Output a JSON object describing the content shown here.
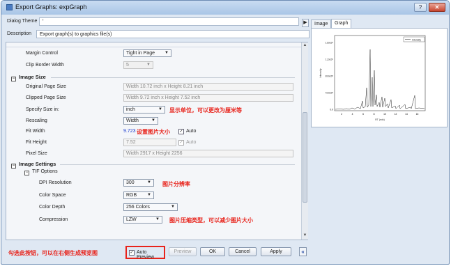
{
  "window": {
    "title": "Export Graphs: expGraph",
    "help": "?",
    "close": "✕"
  },
  "theme": {
    "label": "Dialog Theme",
    "value": "*",
    "arrow": "▶"
  },
  "description": {
    "label": "Description",
    "value": "Export graph(s) to graphics file(s)"
  },
  "margin": {
    "margin_control": {
      "label": "Margin Control",
      "value": "Tight in Page"
    },
    "clip_border": {
      "label": "Clip Border Width",
      "value": "5"
    }
  },
  "image_size": {
    "header": "Image Size",
    "original": {
      "label": "Original Page Size",
      "value": "Width 10.72 inch x Height 8.21 inch"
    },
    "clipped": {
      "label": "Clipped Page Size",
      "value": "Width 9.72 inch x Height 7.52 inch"
    },
    "specify": {
      "label": "Specify Size in:",
      "value": "inch"
    },
    "rescaling": {
      "label": "Rescaling",
      "value": "Width"
    },
    "fit_width": {
      "label": "Fit Width",
      "value": "9.723",
      "auto": "Auto"
    },
    "fit_height": {
      "label": "Fit Height",
      "value": "7.52",
      "auto": "Auto"
    },
    "pixel": {
      "label": "Pixel Size",
      "value": "Width 2917 x Height 2256"
    }
  },
  "image_settings": {
    "header": "Image Settings",
    "tif": "TIF Options",
    "dpi": {
      "label": "DPI Resolution",
      "value": "300"
    },
    "color_space": {
      "label": "Color Space",
      "value": "RGB"
    },
    "color_depth": {
      "label": "Color Depth",
      "value": "256 Colors"
    },
    "compression": {
      "label": "Compression",
      "value": "LZW"
    }
  },
  "annotations": {
    "unit": "显示单位，可以更改为厘米等",
    "fit": "设置图片大小",
    "dpi": "图片分辨率",
    "compression": "图片压缩类型，可以减少图片大小",
    "preview": "勾选此按钮，可以在右侧生成预览图"
  },
  "buttons": {
    "auto_preview": "Auto Preview",
    "preview": "Preview",
    "ok": "OK",
    "cancel": "Cancel",
    "apply": "Apply",
    "collapse": "«"
  },
  "tabs": [
    "Image",
    "Graph"
  ],
  "preview_chart": {
    "legend": "Intensity",
    "y_ticks": [
      "1.6x10⁶",
      "1.2x10⁶",
      "8.0x10⁵",
      "4.0x10⁵",
      "0.0"
    ],
    "x_ticks": [
      "2",
      "4",
      "6",
      "8",
      "10",
      "12",
      "14",
      "16"
    ],
    "y_label": "Intensity",
    "x_label": "RT (min)"
  },
  "colors": {
    "annotation": "#e8231b",
    "fit_value": "#2140d0"
  }
}
